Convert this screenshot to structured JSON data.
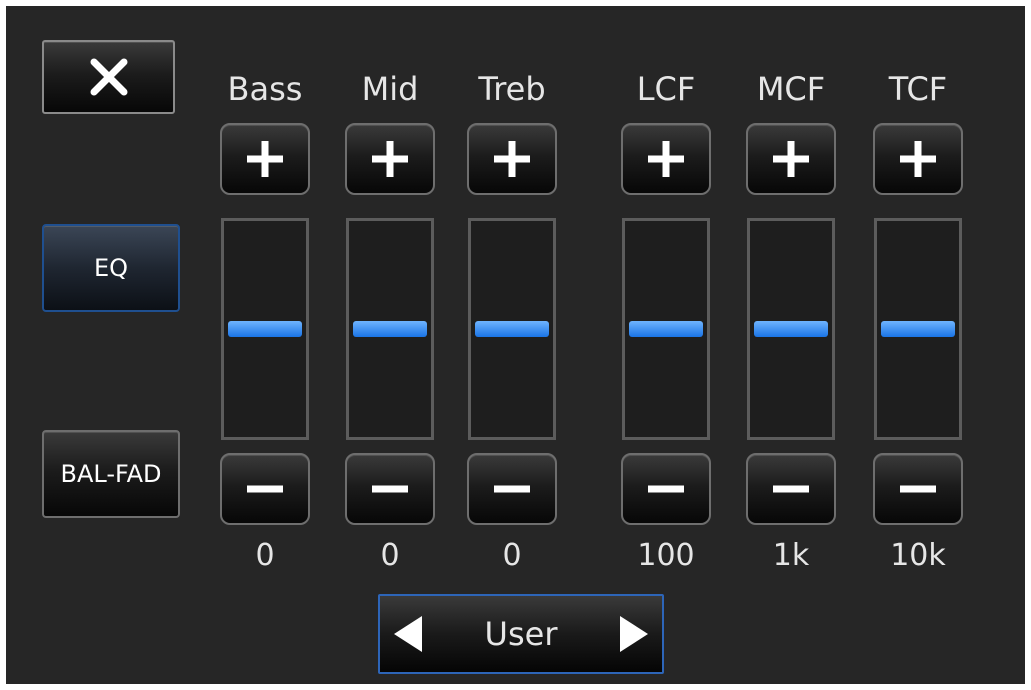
{
  "header": {
    "close_icon": "close-icon"
  },
  "side_menu": {
    "items": [
      {
        "label": "EQ",
        "active": true
      },
      {
        "label": "BAL-FAD",
        "active": false
      }
    ]
  },
  "controls": [
    {
      "name": "Bass",
      "value": "0",
      "level": 0.5
    },
    {
      "name": "Mid",
      "value": "0",
      "level": 0.5
    },
    {
      "name": "Treb",
      "value": "0",
      "level": 0.5
    },
    {
      "name": "LCF",
      "value": "100",
      "level": 0.5
    },
    {
      "name": "MCF",
      "value": "1k",
      "level": 0.5
    },
    {
      "name": "TCF",
      "value": "10k",
      "level": 0.5
    }
  ],
  "preset": {
    "label": "User",
    "prev_icon": "triangle-left-icon",
    "next_icon": "triangle-right-icon"
  },
  "colors": {
    "accent": "#1a74e6",
    "background": "#262626",
    "active_border": "#2d65b8"
  }
}
